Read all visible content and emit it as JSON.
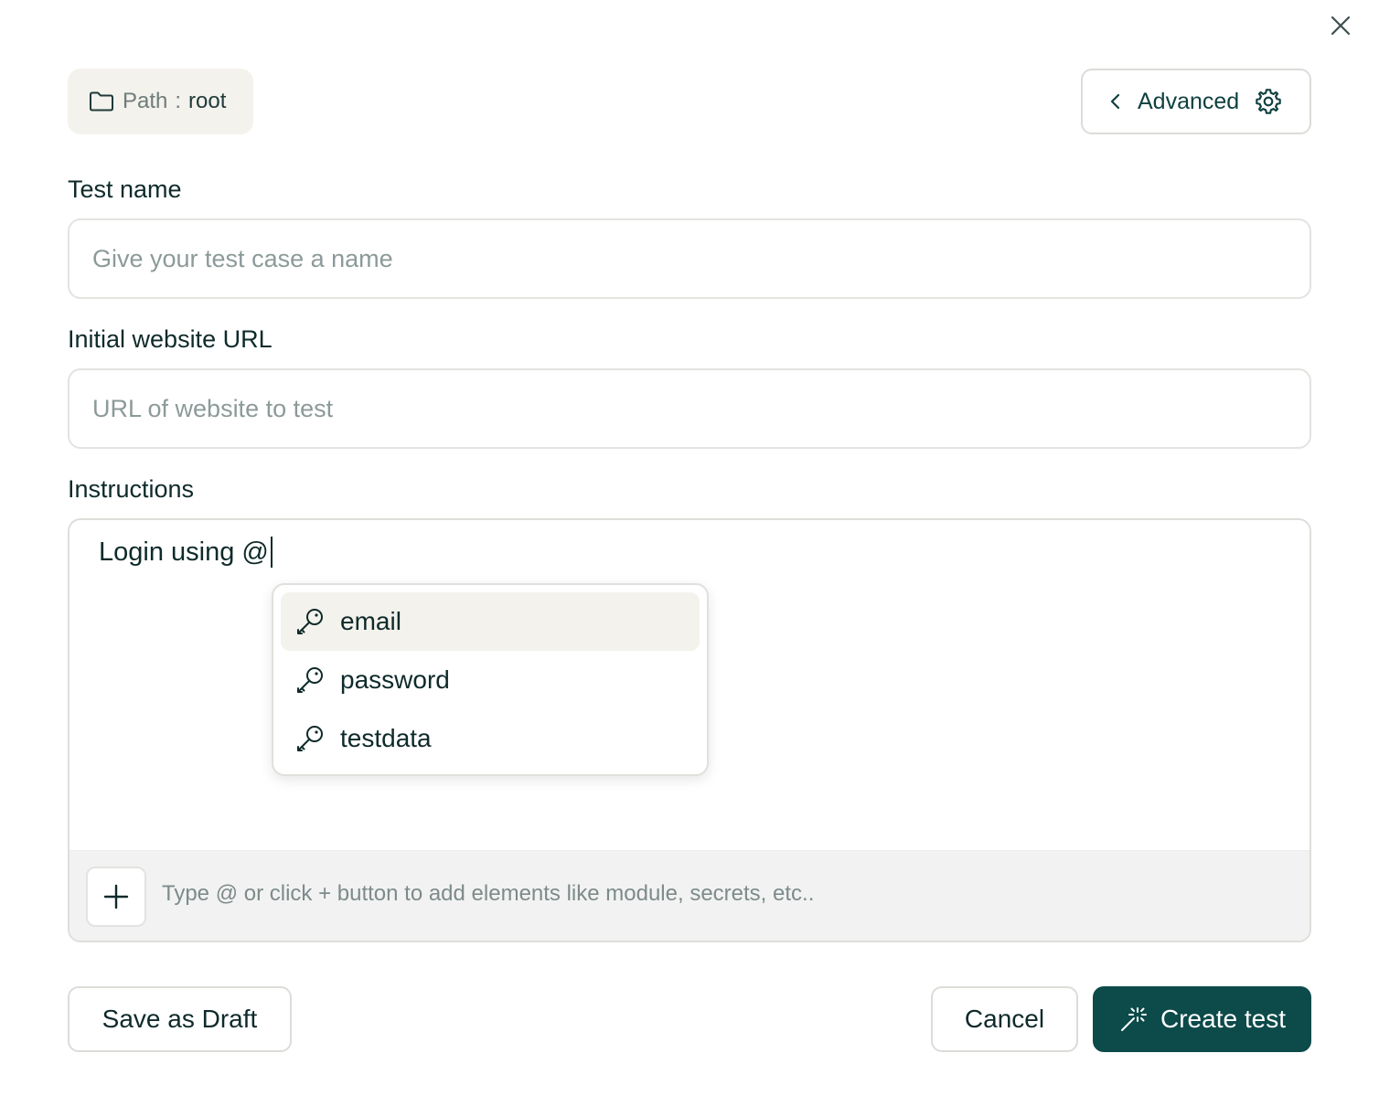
{
  "dialog": {
    "close_icon": "close-icon"
  },
  "path": {
    "icon": "folder-icon",
    "key": "Path",
    "separator": ":",
    "value": "root"
  },
  "advanced": {
    "label": "Advanced",
    "chevron_icon": "chevron-left-icon",
    "gear_icon": "gear-icon"
  },
  "test_name": {
    "label": "Test name",
    "placeholder": "Give your test case a name",
    "value": ""
  },
  "url": {
    "label": "Initial website URL",
    "placeholder": "URL of website to test",
    "value": ""
  },
  "instructions": {
    "label": "Instructions",
    "text": "Login using @",
    "hint": "Type @ or click + button to add elements like module, secrets, etc..",
    "add_icon": "plus-icon"
  },
  "suggestions": {
    "icon": "key-icon",
    "items": [
      {
        "label": "email",
        "active": true
      },
      {
        "label": "password",
        "active": false
      },
      {
        "label": "testdata",
        "active": false
      }
    ]
  },
  "actions": {
    "save_draft": "Save as Draft",
    "cancel": "Cancel",
    "create": "Create test",
    "create_icon": "magic-wand-icon"
  },
  "colors": {
    "primary": "#0d4a4a",
    "chip_bg": "#f3f2ec",
    "placeholder": "#8c9a99",
    "footer_bg": "#f2f2f2"
  }
}
